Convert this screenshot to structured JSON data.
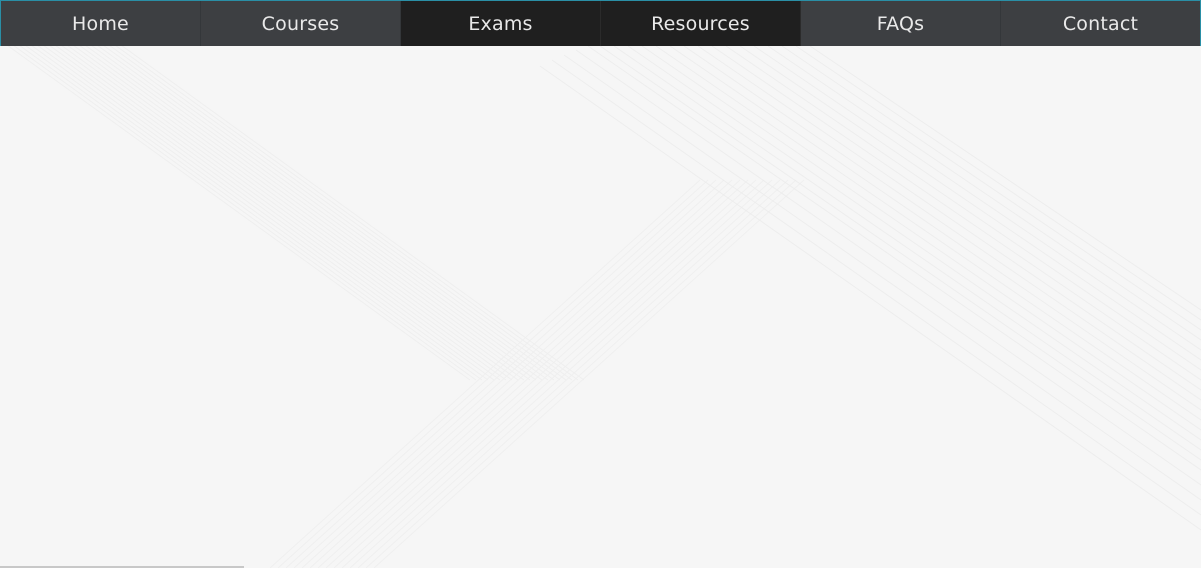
{
  "nav": {
    "items": [
      {
        "label": "Home"
      },
      {
        "label": "Courses"
      },
      {
        "label": "Exams"
      },
      {
        "label": "Resources"
      },
      {
        "label": "FAQs"
      },
      {
        "label": "Contact"
      }
    ]
  },
  "colors": {
    "nav_background": "#3d3f42",
    "nav_dark_background": "#1f1f1f",
    "nav_accent_border": "#2a8fa6",
    "page_background": "#f6f6f6"
  }
}
